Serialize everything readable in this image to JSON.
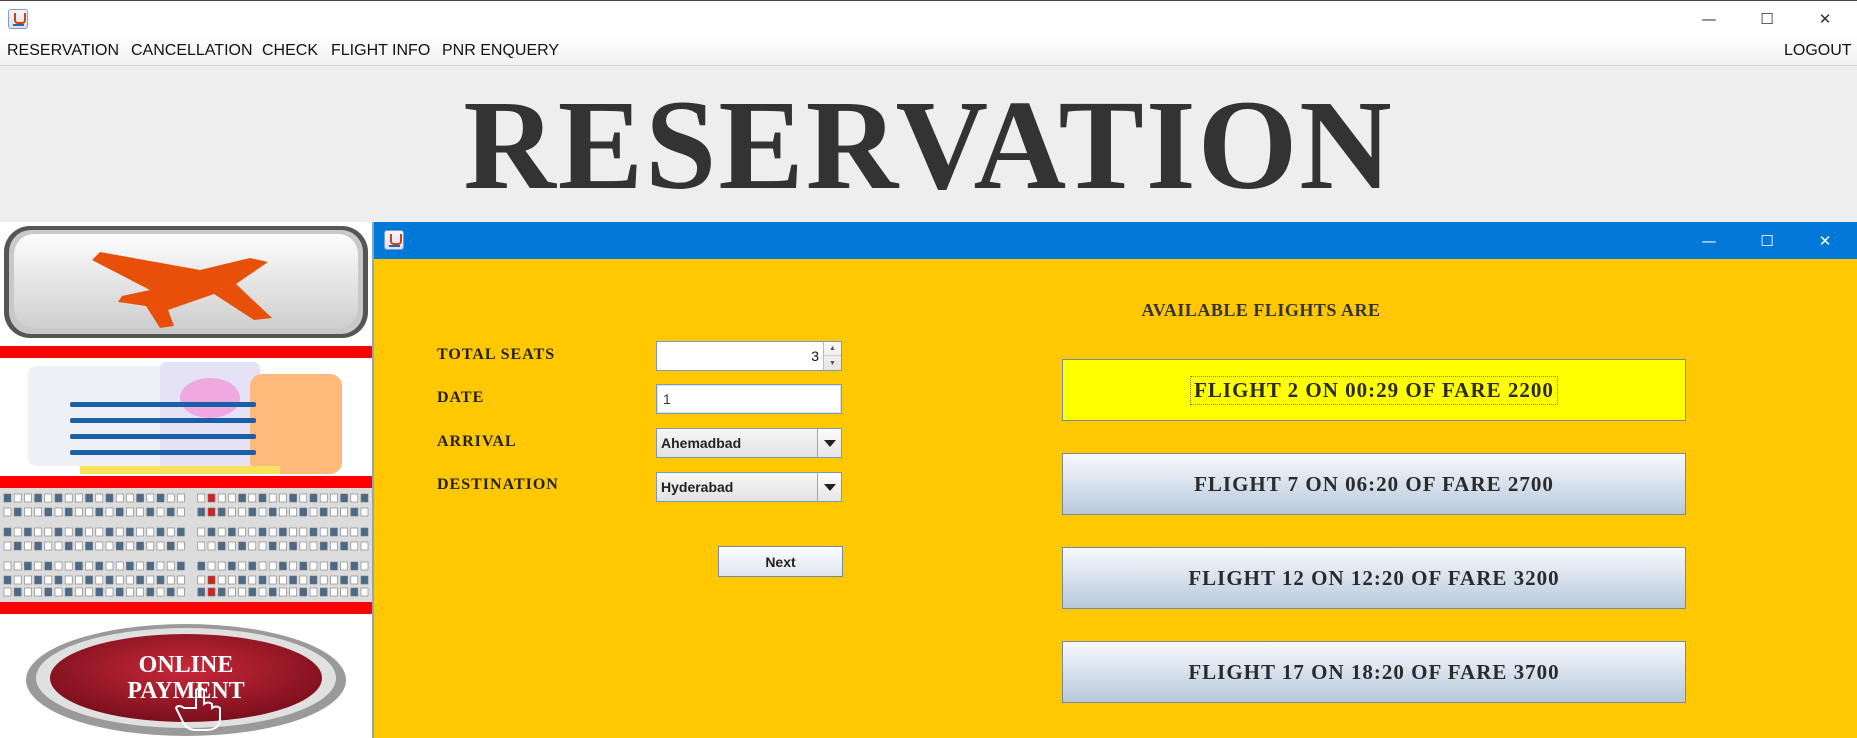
{
  "window": {
    "controls": {
      "minimize": "—",
      "maximize": "☐",
      "close": "✕"
    }
  },
  "menubar": {
    "items": [
      "RESERVATION",
      "CANCELLATION",
      "CHECK",
      "FLIGHT INFO",
      "PNR ENQUERY"
    ],
    "logout": "LOGOUT"
  },
  "banner": {
    "title": "RESERVATION"
  },
  "sidebar": {
    "images": [
      "airplane-button-image",
      "ticket-document-image",
      "seat-map-image",
      "online-payment-image"
    ],
    "payment_text": [
      "ONLINE",
      "PAYMENT"
    ]
  },
  "inner_window": {
    "controls": {
      "minimize": "—",
      "maximize": "☐",
      "close": "✕"
    }
  },
  "form": {
    "total_seats_label": "TOTAL SEATS",
    "total_seats_value": "3",
    "date_label": "DATE",
    "date_value": "1",
    "arrival_label": "ARRIVAL",
    "arrival_value": "Ahemadbad",
    "destination_label": "DESTINATION",
    "destination_value": "Hyderabad",
    "next_label": "Next"
  },
  "flights": {
    "heading": "AVAILABLE FLIGHTS ARE",
    "options": [
      "FLIGHT 2 ON 00:29 OF FARE 2200",
      "FLIGHT 7 ON 06:20 OF FARE 2700",
      "FLIGHT 12 ON 12:20 OF FARE 3200",
      "FLIGHT 17 ON 18:20 OF FARE 3700"
    ],
    "selected_index": 0
  },
  "colors": {
    "inner_background": "#ffc800",
    "titlebar_blue": "#0078d7",
    "selected_flight": "#ffff00",
    "sidebar_separator": "#ff0000",
    "airplane_orange": "#e8500a"
  }
}
